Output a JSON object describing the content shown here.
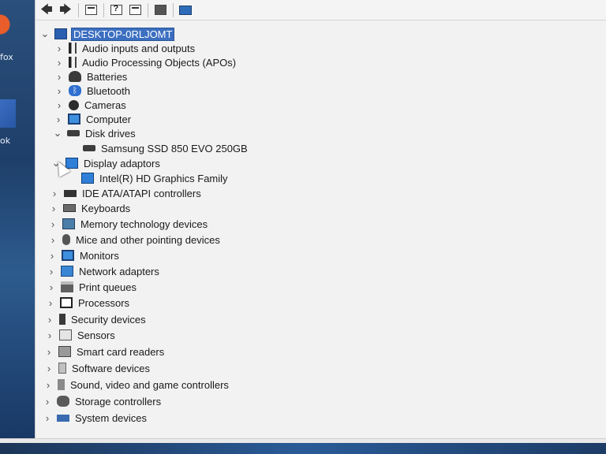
{
  "desktop": {
    "icon_labels": [
      "fox",
      "ok"
    ]
  },
  "toolbar": {
    "buttons": [
      "back-icon",
      "forward-icon",
      "properties-icon",
      "help-icon",
      "view-icon",
      "update-driver-icon",
      "scan-monitor-icon"
    ]
  },
  "tree": {
    "root": "DESKTOP-0RLJOMT",
    "items": [
      {
        "label": "Audio inputs and outputs",
        "expander": "›",
        "icon": "speaker-icon"
      },
      {
        "label": "Audio Processing Objects (APOs)",
        "expander": "›",
        "icon": "speaker-icon"
      },
      {
        "label": "Batteries",
        "expander": "›",
        "icon": "battery-icon"
      },
      {
        "label": "Bluetooth",
        "expander": "›",
        "icon": "bluetooth-icon"
      },
      {
        "label": "Cameras",
        "expander": "›",
        "icon": "camera-icon"
      },
      {
        "label": "Computer",
        "expander": "›",
        "icon": "computer-icon"
      },
      {
        "label": "Disk drives",
        "expander": "⌄",
        "icon": "disk-icon"
      },
      {
        "label": "Samsung SSD 850 EVO 250GB",
        "expander": "",
        "icon": "disk-icon",
        "child": true
      },
      {
        "label": "Display adaptors",
        "expander": "⌄",
        "icon": "display-icon"
      },
      {
        "label": "Intel(R) HD Graphics Family",
        "expander": "",
        "icon": "display-icon",
        "child": true
      },
      {
        "label": "IDE ATA/ATAPI controllers",
        "expander": "›",
        "icon": "ide-icon"
      },
      {
        "label": "Keyboards",
        "expander": "›",
        "icon": "keyboard-icon"
      },
      {
        "label": "Memory technology devices",
        "expander": "›",
        "icon": "memory-icon"
      },
      {
        "label": "Mice and other pointing devices",
        "expander": "›",
        "icon": "mouse-icon"
      },
      {
        "label": "Monitors",
        "expander": "›",
        "icon": "monitor-icon"
      },
      {
        "label": "Network adapters",
        "expander": "›",
        "icon": "network-icon"
      },
      {
        "label": "Print queues",
        "expander": "›",
        "icon": "printer-icon"
      },
      {
        "label": "Processors",
        "expander": "›",
        "icon": "processor-icon"
      },
      {
        "label": "Security devices",
        "expander": "›",
        "icon": "security-icon"
      },
      {
        "label": "Sensors",
        "expander": "›",
        "icon": "sensor-icon"
      },
      {
        "label": "Smart card readers",
        "expander": "›",
        "icon": "smartcard-icon"
      },
      {
        "label": "Software devices",
        "expander": "›",
        "icon": "software-icon"
      },
      {
        "label": "Sound, video and game controllers",
        "expander": "›",
        "icon": "sound-icon"
      },
      {
        "label": "Storage controllers",
        "expander": "›",
        "icon": "storage-icon"
      },
      {
        "label": "System devices",
        "expander": "›",
        "icon": "system-icon"
      }
    ]
  }
}
